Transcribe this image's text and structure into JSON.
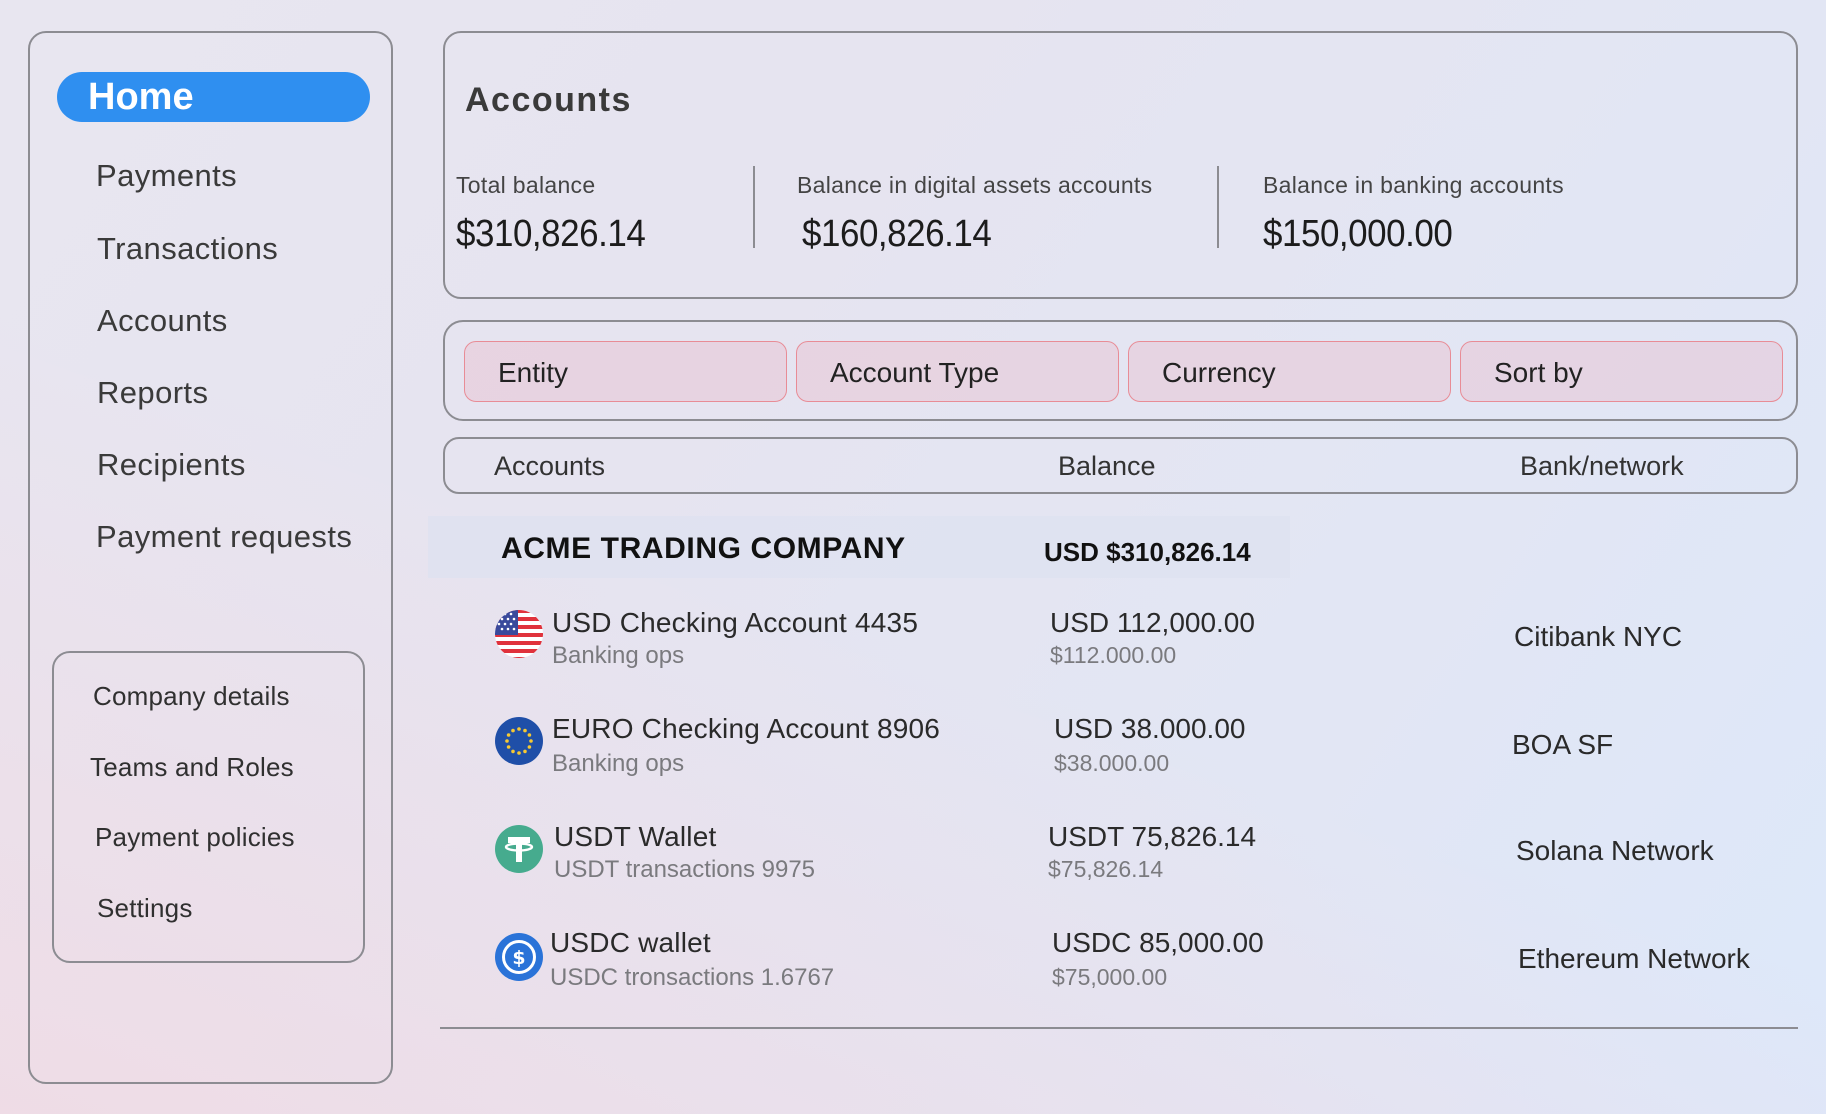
{
  "sidebar": {
    "home_label": "Home",
    "items": [
      {
        "label": "Payments"
      },
      {
        "label": "Transactions"
      },
      {
        "label": "Accounts"
      },
      {
        "label": "Reports"
      },
      {
        "label": "Recipients"
      },
      {
        "label": "Payment requests"
      }
    ],
    "sub_items": [
      {
        "label": "Company details"
      },
      {
        "label": "Teams and Roles"
      },
      {
        "label": "Payment policies"
      },
      {
        "label": "Settings"
      }
    ],
    "accent_color": "#2f8ff0"
  },
  "summary": {
    "title": "Accounts",
    "stats": [
      {
        "label": "Total balance",
        "value": "$310,826.14"
      },
      {
        "label": "Balance in digital assets accounts",
        "value": "$160,826.14"
      },
      {
        "label": "Balance in banking accounts",
        "value": "$150,000.00"
      }
    ]
  },
  "filters": [
    {
      "label": "Entity"
    },
    {
      "label": "Account Type"
    },
    {
      "label": "Currency"
    },
    {
      "label": "Sort by"
    }
  ],
  "table": {
    "columns": [
      "Accounts",
      "Balance",
      "Bank/network"
    ],
    "company": {
      "name": "ACME TRADING COMPANY",
      "total": "USD $310,826.14"
    },
    "rows": [
      {
        "icon": "us-flag-icon",
        "name": "USD Checking Account 4435",
        "sub": "Banking ops",
        "balance": "USD 112,000.00",
        "balance_sub": "$112.000.00",
        "bank": "Citibank NYC"
      },
      {
        "icon": "eu-flag-icon",
        "name": "EURO Checking Account 8906",
        "sub": "Banking ops",
        "balance": "USD 38.000.00",
        "balance_sub": "$38.000.00",
        "bank": "BOA SF"
      },
      {
        "icon": "tether-icon",
        "name": "USDT Wallet",
        "sub": "USDT transactions 9975",
        "balance": "USDT 75,826.14",
        "balance_sub": "$75,826.14",
        "bank": "Solana Network"
      },
      {
        "icon": "usdc-icon",
        "name": "USDC wallet",
        "sub": "USDC tronsactions 1.6767",
        "balance": "USDC 85,000.00",
        "balance_sub": "$75,000.00",
        "bank": "Ethereum Network"
      }
    ]
  }
}
